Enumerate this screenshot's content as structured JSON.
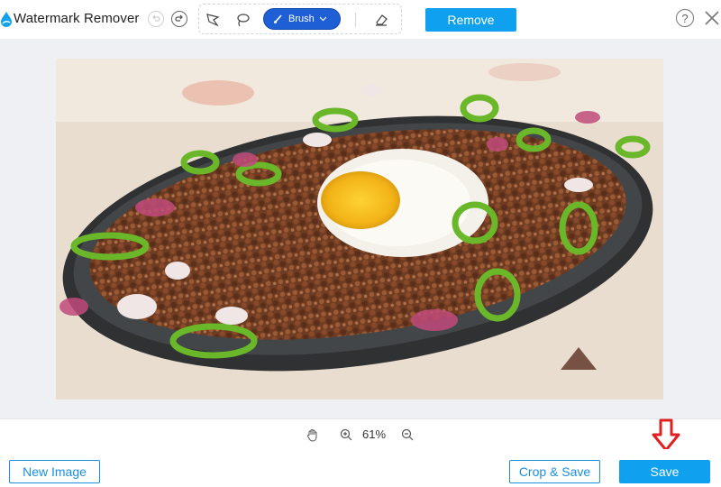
{
  "app": {
    "title": "Watermark Remover",
    "accent": "#0fa0f0",
    "brush_color": "#1f5fd6"
  },
  "toolbar": {
    "undo_icon": "undo-icon",
    "redo_icon": "redo-icon",
    "tools": [
      "polygon-lasso-icon",
      "lasso-icon",
      "brush-icon",
      "eraser-icon"
    ],
    "brush_label": "Brush",
    "remove_label": "Remove"
  },
  "zoom": {
    "level": "61%"
  },
  "footer": {
    "new_image_label": "New Image",
    "crop_save_label": "Crop & Save",
    "save_label": "Save",
    "annotation_color": "#e02020"
  }
}
